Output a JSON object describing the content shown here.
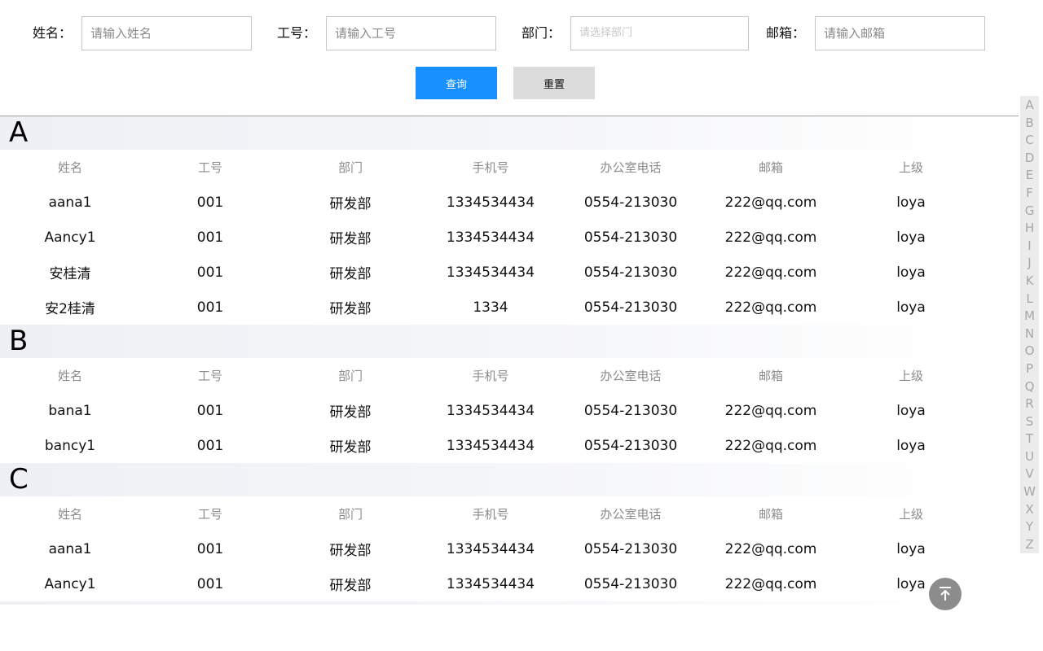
{
  "search": {
    "name_label": "姓名：",
    "name_placeholder": "请输入姓名",
    "id_label": "工号：",
    "id_placeholder": "请输入工号",
    "dept_label": "部门：",
    "dept_placeholder": "请选择部门",
    "email_label": "邮箱：",
    "email_placeholder": "请输入邮箱",
    "query_button": "查询",
    "reset_button": "重置"
  },
  "columns": [
    "姓名",
    "工号",
    "部门",
    "手机号",
    "办公室电话",
    "邮箱",
    "上级"
  ],
  "groups": [
    {
      "letter": "A",
      "rows": [
        [
          "aana1",
          "001",
          "研发部",
          "1334534434",
          "0554-213030",
          "222@qq.com",
          "loya"
        ],
        [
          "Aancy1",
          "001",
          "研发部",
          "1334534434",
          "0554-213030",
          "222@qq.com",
          "loya"
        ],
        [
          "安桂清",
          "001",
          "研发部",
          "1334534434",
          "0554-213030",
          "222@qq.com",
          "loya"
        ],
        [
          "安2桂清",
          "001",
          "研发部",
          "1334",
          "0554-213030",
          "222@qq.com",
          "loya"
        ]
      ]
    },
    {
      "letter": "B",
      "rows": [
        [
          "bana1",
          "001",
          "研发部",
          "1334534434",
          "0554-213030",
          "222@qq.com",
          "loya"
        ],
        [
          "bancy1",
          "001",
          "研发部",
          "1334534434",
          "0554-213030",
          "222@qq.com",
          "loya"
        ]
      ]
    },
    {
      "letter": "C",
      "rows": [
        [
          "aana1",
          "001",
          "研发部",
          "1334534434",
          "0554-213030",
          "222@qq.com",
          "loya"
        ],
        [
          "Aancy1",
          "001",
          "研发部",
          "1334534434",
          "0554-213030",
          "222@qq.com",
          "loya"
        ]
      ]
    }
  ],
  "alphabet": [
    "A",
    "B",
    "C",
    "D",
    "E",
    "F",
    "G",
    "H",
    "I",
    "J",
    "K",
    "L",
    "M",
    "N",
    "O",
    "P",
    "Q",
    "R",
    "S",
    "T",
    "U",
    "V",
    "W",
    "X",
    "Y",
    "Z"
  ],
  "colors": {
    "primary": "#1890ff",
    "reset_bg": "#dcdcdc",
    "back_top_bg": "#8c8c8c"
  },
  "icons": {
    "back_to_top": "arrow-up-to-line-icon"
  }
}
